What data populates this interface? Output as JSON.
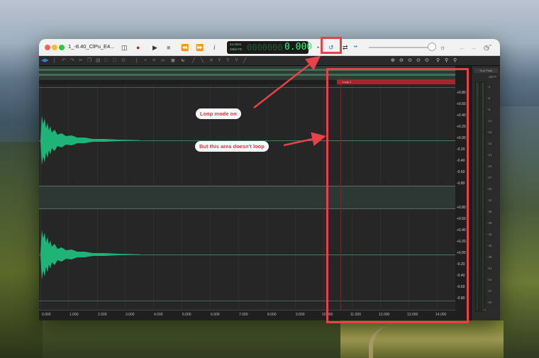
{
  "window": {
    "title": "1_-8.40_ClPu_E4...",
    "toolbar_icons": [
      "sidebar-icon",
      "record-icon",
      "play-icon",
      "stop-icon",
      "rewind-icon",
      "fast-forward-icon",
      "info-icon",
      "speed-icon",
      "loop-icon",
      "repeat-icon",
      "dot-icon",
      "volume-knob-icon",
      "bypass-icon",
      "back-icon",
      "forward-icon",
      "history-icon"
    ],
    "info_label": "i"
  },
  "counter": {
    "sample_rate": "44.1kHz",
    "bit_depth": "32bit FD",
    "ghost": "0000000",
    "time": "0.000"
  },
  "loop_region": {
    "label": "Loop 1"
  },
  "meter": {
    "header": "True Peak",
    "unit": "dBTP",
    "scale": [
      "-3",
      "-6",
      "-9",
      "-12",
      "-15",
      "-18",
      "-21",
      "-24",
      "-27",
      "-30",
      "-33",
      "-36",
      "-39",
      "-42",
      "-45",
      "-48",
      "-51",
      "-54",
      "-57",
      "-60"
    ]
  },
  "amp_labels_top": [
    "+0.80",
    "+0.60",
    "+0.40",
    "+0.20",
    "+0.00",
    "-0.20",
    "-0.40",
    "-0.60",
    "-0.80"
  ],
  "amp_labels_bottom": [
    "+0.80",
    "+0.60",
    "+0.40",
    "+0.20",
    "+0.00",
    "-0.20",
    "-0.40",
    "-0.60",
    "-0.80"
  ],
  "ruler": [
    "0.000",
    "1.000",
    "2.000",
    "3.000",
    "4.000",
    "5.000",
    "6.000",
    "7.000",
    "8.000",
    "9.000",
    "10.000",
    "11.000",
    "12.000",
    "13.000",
    "14.000"
  ],
  "annotations": {
    "loop_mode": "Loop mode on",
    "no_loop": "But this area doesn't loop"
  },
  "colors": {
    "waveform": "#1fb377",
    "annotation": "#e8414a",
    "loop_region": "#a3282b"
  }
}
